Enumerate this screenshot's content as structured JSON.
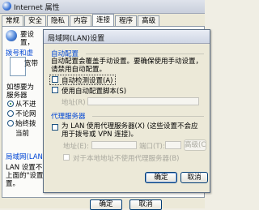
{
  "background_window": {
    "title": "Internet 属性",
    "tabs": [
      "常规",
      "安全",
      "隐私",
      "内容",
      "连接",
      "程序",
      "高级"
    ],
    "active_tab": 4,
    "fragments": {
      "setup_line1": "要设",
      "setup_line2": "置，",
      "dialup_group": "拨号和虚",
      "dialup_item": "宽带",
      "question_line": "如想要为",
      "question_line2": "服务器",
      "radio_never": "从不进",
      "radio_when_no_net": "不论网",
      "radio_always": "始终拨",
      "current_line": "当前",
      "lan_group": "局域网(LAN",
      "lan_line1": "LAN 设置不",
      "lan_line2": "上面的\"设置\"",
      "lan_line3": "置。"
    },
    "bottom_buttons": [
      "确定",
      "取消"
    ]
  },
  "dialog": {
    "title": "局域网(LAN)设置",
    "auto_config": {
      "title": "自动配置",
      "description": "自动配置会覆盖手动设置。要确保使用手动设置，请禁用自动配置。",
      "detect_label": "自动检测设置(A)",
      "detect_checked": false,
      "script_label": "使用自动配置脚本(S)",
      "script_checked": false,
      "address_label": "地址(R)"
    },
    "proxy": {
      "title": "代理服务器",
      "use_proxy_label": "为 LAN 使用代理服务器(X) (这些设置不会应用于拨号或 VPN 连接)。",
      "use_proxy_checked": false,
      "address_label": "地址(E):",
      "port_label": "端口(T):",
      "advanced_label": "高级(C)",
      "bypass_label": "对于本地地址不使用代理服务器(B)",
      "bypass_checked": false
    },
    "buttons": {
      "ok": "确定",
      "cancel": "取消"
    }
  }
}
